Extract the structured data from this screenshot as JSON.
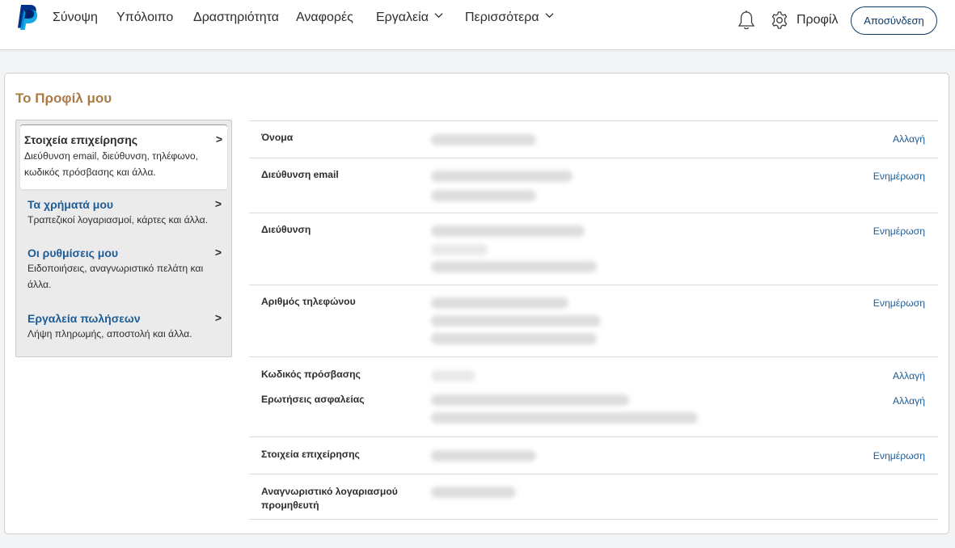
{
  "header": {
    "nav": [
      "Σύνοψη",
      "Υπόλοιπο",
      "Δραστηριότητα",
      "Αναφορές",
      "Εργαλεία",
      "Περισσότερα"
    ],
    "profile_label": "Προφίλ",
    "logout_label": "Αποσύνδεση",
    "icons": [
      "paypal-logo",
      "bell-icon",
      "gear-icon",
      "chevron-down-icon"
    ]
  },
  "page": {
    "title": "Το Προφίλ μου"
  },
  "sidebar": {
    "items": [
      {
        "title": "Στοιχεία επιχείρησης",
        "description": "Διεύθυνση email, διεύθυνση, τηλέφωνο, κωδικός πρόσβασης και άλλα.",
        "active": true
      },
      {
        "title": "Τα χρήματά μου",
        "description": "Τραπεζικοί λογαριασμοί, κάρτες και άλλα.",
        "active": false
      },
      {
        "title": "Οι ρυθμίσεις μου",
        "description": "Ειδοποιήσεις, αναγνωριστικό πελάτη και άλλα.",
        "active": false
      },
      {
        "title": "Εργαλεία πωλήσεων",
        "description": "Λήψη πληρωμής, αποστολή και άλλα.",
        "active": false
      }
    ]
  },
  "rows": [
    {
      "label": "Όνομα",
      "action": "Αλλαγή"
    },
    {
      "label": "Διεύθυνση email",
      "action": "Ενημέρωση"
    },
    {
      "label": "Διεύθυνση",
      "action": "Ενημέρωση"
    },
    {
      "label": "Αριθμός τηλεφώνου",
      "action": "Ενημέρωση"
    },
    {
      "label": "Κωδικός πρόσβασης",
      "action": "Αλλαγή"
    },
    {
      "label": "Ερωτήσεις ασφαλείας",
      "action": "Αλλαγή"
    },
    {
      "label": "Στοιχεία επιχείρησης",
      "action": "Ενημέρωση"
    },
    {
      "label": "Αναγνωριστικό λογαριασμού προμηθευτή",
      "action": ""
    }
  ],
  "colors": {
    "accent_title": "#a97b47",
    "link": "#1e5c96",
    "button_border": "#0c3a69",
    "page_bg": "#f3f4f6"
  }
}
